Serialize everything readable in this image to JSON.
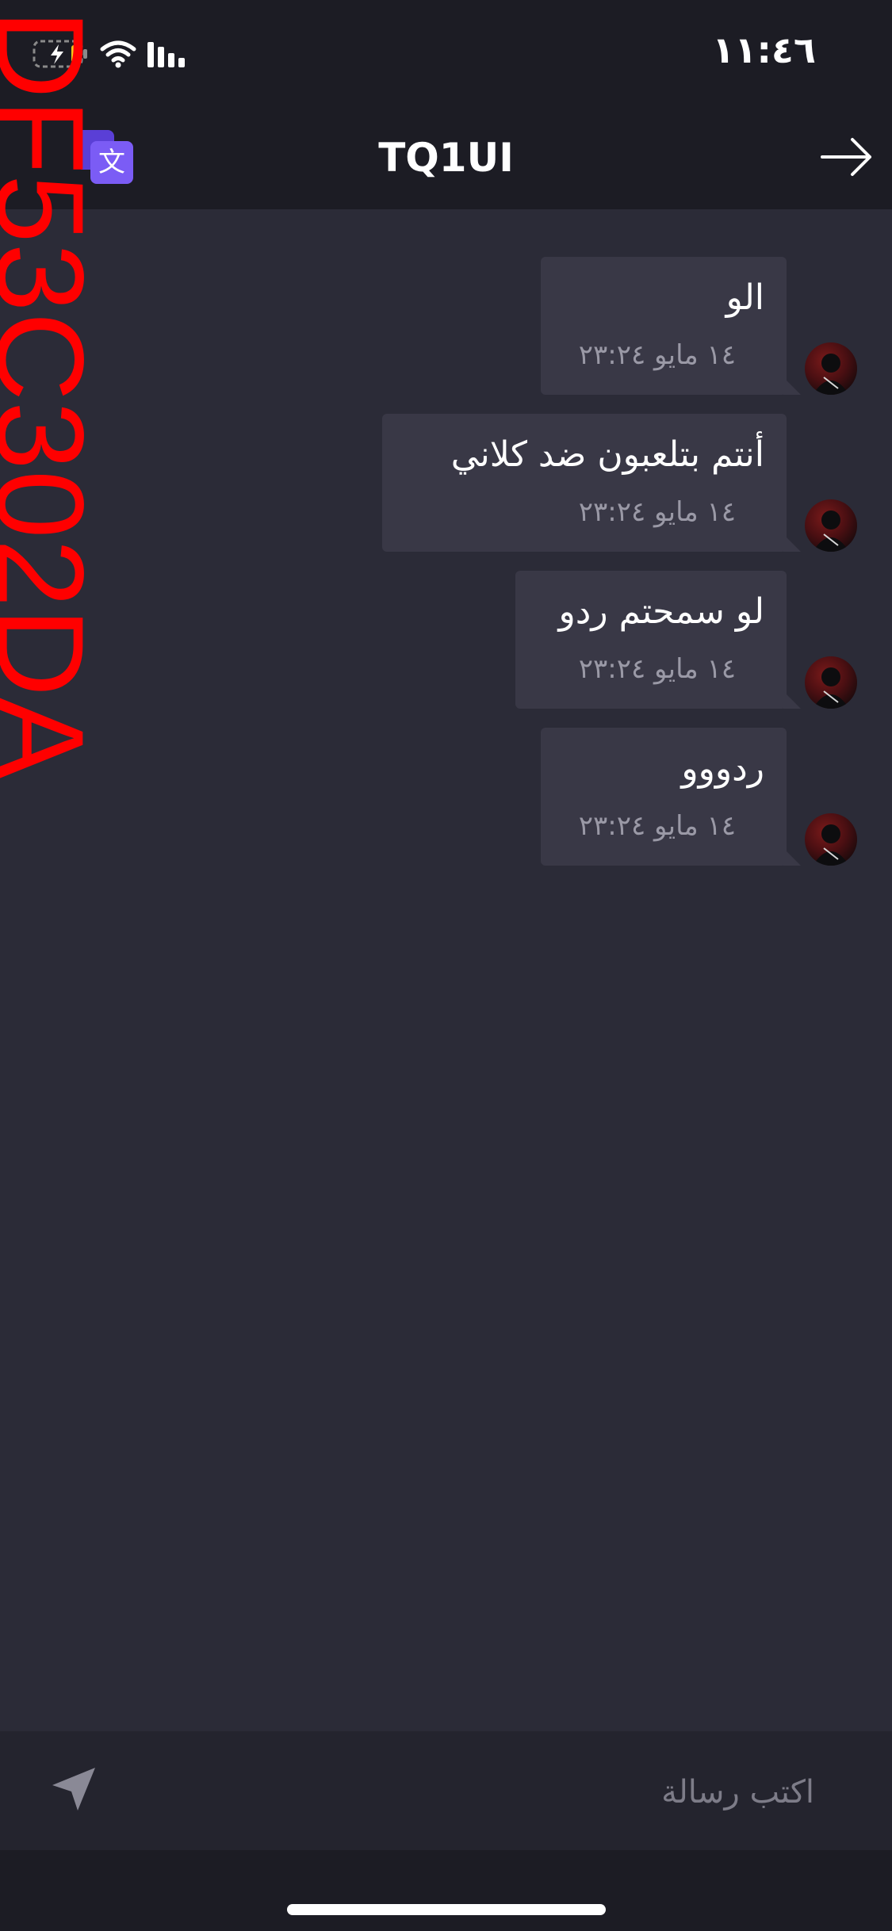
{
  "status_bar": {
    "time": "١١:٤٦"
  },
  "header": {
    "title": "TQ1UI",
    "translate_icon": "translate-icon",
    "back_icon": "arrow-right-icon"
  },
  "watermark": {
    "text": "DF53C302DA"
  },
  "messages": [
    {
      "text": "الو",
      "time": "١٤ مايو ٢٣:٢٤"
    },
    {
      "text": "أنتم بتلعبون ضد كلاني",
      "time": "١٤ مايو ٢٣:٢٤"
    },
    {
      "text": "لو سمحتم ردو",
      "time": "١٤ مايو ٢٣:٢٤"
    },
    {
      "text": "ردووو",
      "time": "١٤ مايو ٢٣:٢٤"
    }
  ],
  "composer": {
    "placeholder": "اكتب رسالة",
    "send_icon": "send-icon"
  },
  "colors": {
    "background": "#2b2b37",
    "header": "#1c1c24",
    "bubble": "#393846",
    "timestamp": "#9a99a6",
    "accent": "#7b5cf5"
  }
}
